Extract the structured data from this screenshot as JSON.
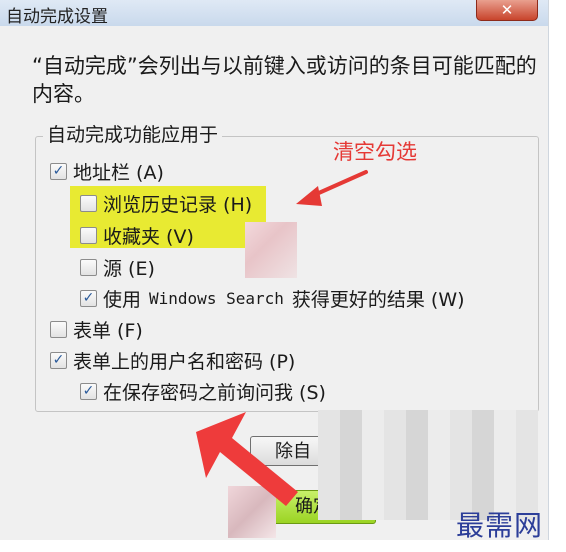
{
  "window": {
    "title": "自动完成设置",
    "close_label": "✕"
  },
  "description": "“自动完成”会列出与以前键入或访问的条目可能匹配的内容。",
  "group": {
    "legend": "自动完成功能应用于",
    "options": [
      {
        "label": "地址栏 (A)",
        "checked": true
      },
      {
        "label": "浏览历史记录 (H)",
        "checked": false,
        "highlighted": true
      },
      {
        "label": "收藏夹 (V)",
        "checked": false,
        "highlighted": true
      },
      {
        "label": "源 (E)",
        "checked": false
      },
      {
        "label_prefix": "使用",
        "label_mono": "Windows Search",
        "label_suffix": "获得更好的结果 (W)",
        "checked": true
      },
      {
        "label": "表单 (F)",
        "checked": false
      },
      {
        "label": "表单上的用户名和密码 (P)",
        "checked": true
      },
      {
        "label": "在保存密码之前询问我 (S)",
        "checked": true
      }
    ]
  },
  "buttons": {
    "delete_partial": "除自",
    "ok": "确定"
  },
  "annotation": "清空勾选",
  "watermark": "最需网",
  "colors": {
    "highlight": "#e8ea32",
    "annotation_red": "#e53935",
    "ok_button_green": "#a6e22e"
  }
}
